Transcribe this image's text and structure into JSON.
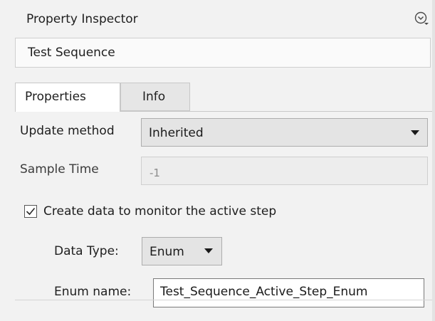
{
  "panel": {
    "title": "Property Inspector",
    "menu_icon": "chevron-down-circle-icon"
  },
  "block": {
    "name": "Test Sequence"
  },
  "tabs": [
    {
      "label": "Properties",
      "active": true
    },
    {
      "label": "Info",
      "active": false
    }
  ],
  "properties": {
    "update_method": {
      "label": "Update method",
      "value": "Inherited"
    },
    "sample_time": {
      "label": "Sample Time",
      "value": "-1",
      "enabled": false
    },
    "monitor_active_step": {
      "label": "Create data to monitor the active step",
      "checked": true
    },
    "data_type": {
      "label": "Data Type:",
      "value": "Enum"
    },
    "enum_name": {
      "label": "Enum name:",
      "value": "Test_Sequence_Active_Step_Enum"
    }
  },
  "colors": {
    "panel_bg": "#f2f2f2",
    "tab_active_bg": "#ffffff",
    "tab_inactive_bg": "#e6e6e6",
    "dropdown_bg": "#e4e4e4",
    "disabled_text": "#8c8c8c"
  }
}
